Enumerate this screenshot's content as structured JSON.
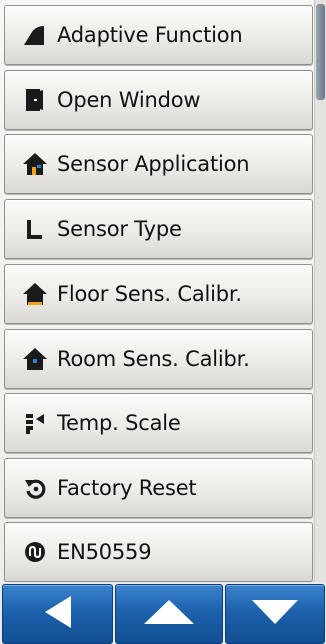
{
  "menu": {
    "items": [
      {
        "label": "Adaptive Function",
        "icon": "adaptive-wedge-icon"
      },
      {
        "label": "Open Window",
        "icon": "open-window-door-icon"
      },
      {
        "label": "Sensor Application",
        "icon": "house-sensor-icon"
      },
      {
        "label": "Sensor Type",
        "icon": "l-shape-sensor-icon"
      },
      {
        "label": "Floor Sens. Calibr.",
        "icon": "house-floor-icon"
      },
      {
        "label": "Room Sens. Calibr.",
        "icon": "house-room-icon"
      },
      {
        "label": "Temp. Scale",
        "icon": "temp-scale-icon"
      },
      {
        "label": "Factory Reset",
        "icon": "reset-arrow-icon"
      },
      {
        "label": "EN50559",
        "icon": "en50559-icon"
      }
    ]
  },
  "nav": {
    "buttons": [
      {
        "icon": "back-arrow-icon"
      },
      {
        "icon": "up-arrow-icon"
      },
      {
        "icon": "down-arrow-icon"
      }
    ]
  },
  "colors": {
    "nav_button": "#1d62ad",
    "nav_border": "#0d3f77",
    "icon_dark": "#1a1a1a",
    "scroll_thumb": "#7a8696"
  }
}
